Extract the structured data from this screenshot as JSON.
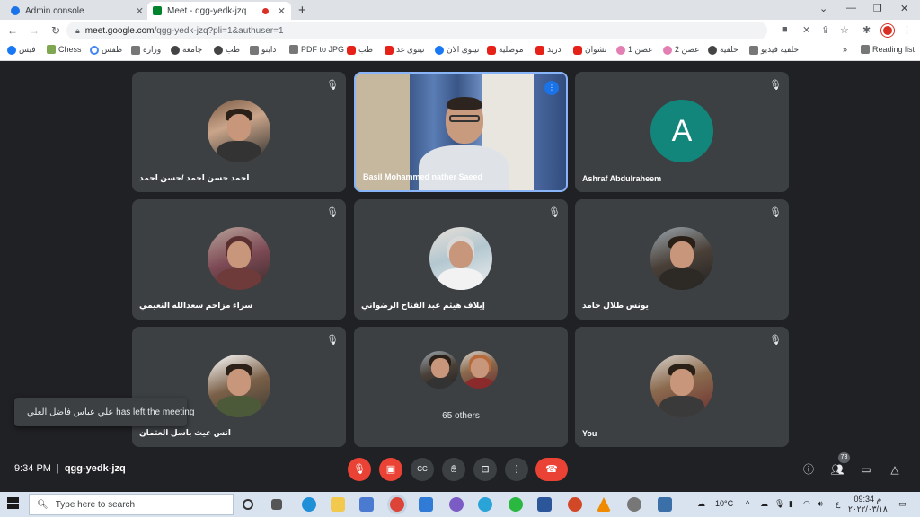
{
  "browser": {
    "tabs": [
      {
        "label": "Admin console",
        "active": false
      },
      {
        "label": "Meet - qgg-yedk-jzq",
        "active": true,
        "recording": true
      }
    ],
    "new_tab": "+",
    "window_controls": {
      "minimize": "⌄",
      "min2": "—",
      "maximize": "❐",
      "close": "✕"
    },
    "url_host": "meet.google.com",
    "url_path": "/qgg-yedk-jzq?pli=1&authuser=1",
    "bookmarks": [
      {
        "label": "فيس",
        "icon": "facebook-icon"
      },
      {
        "label": "Chess",
        "icon": "chess-icon"
      },
      {
        "label": "طقس",
        "icon": "google-icon"
      },
      {
        "label": "وزارة",
        "icon": "globe-icon"
      },
      {
        "label": "جامعة",
        "icon": "avatar-icon"
      },
      {
        "label": "طب",
        "icon": "avatar-icon"
      },
      {
        "label": "داينو",
        "icon": "dino-icon"
      },
      {
        "label": "PDF to JPG",
        "icon": "pdf-icon"
      },
      {
        "label": "طب",
        "icon": "youtube-icon"
      },
      {
        "label": "نينوى غد",
        "icon": "youtube-icon"
      },
      {
        "label": "نينوى الان",
        "icon": "facebook-icon"
      },
      {
        "label": "موصلية",
        "icon": "youtube-icon"
      },
      {
        "label": "دريد",
        "icon": "youtube-icon"
      },
      {
        "label": "نشوان",
        "icon": "youtube-icon"
      },
      {
        "label": "عصن 1",
        "icon": "flower-icon"
      },
      {
        "label": "عصن 2",
        "icon": "flower-icon"
      },
      {
        "label": "خلفية",
        "icon": "graduation-icon"
      },
      {
        "label": "خلفية فيديو",
        "icon": "video-icon"
      }
    ],
    "bookmarks_more": "»",
    "reading_list": "Reading list"
  },
  "meet": {
    "tiles": [
      {
        "name": "احمد حسن احمد /حسن احمد",
        "muted": true,
        "type": "photo"
      },
      {
        "name": "Basil Mohammed nather Saeed",
        "muted": false,
        "type": "speaker",
        "speaking": true
      },
      {
        "name": "Ashraf Abdulraheem",
        "muted": true,
        "type": "letter",
        "letter": "A"
      },
      {
        "name": "سراء مزاحم سعدالله النعيمي",
        "muted": true,
        "type": "photo"
      },
      {
        "name": "إيلاف هيثم عبد الفتاح الرضواني",
        "muted": true,
        "type": "photo"
      },
      {
        "name": "يونس طلال حامد",
        "muted": true,
        "type": "photo"
      },
      {
        "name": "انس غيث باسل العثمان",
        "muted": true,
        "type": "photo"
      },
      {
        "name": "65 others",
        "muted": false,
        "type": "others"
      },
      {
        "name": "You",
        "muted": true,
        "type": "photo"
      }
    ],
    "toast": "علي عباس فاضل العلي has left the meeting",
    "time": "9:34 PM",
    "separator": "|",
    "meeting_code": "qgg-yedk-jzq",
    "people_count": "73",
    "colors": {
      "background": "#202124",
      "tile": "#3c4043",
      "accent": "#8ab4f8",
      "danger": "#ea4335",
      "avatar_letter_bg": "#12867b"
    }
  },
  "taskbar": {
    "search_placeholder": "Type here to search",
    "weather": "10°C",
    "lang": "ع",
    "time": "09:34 م",
    "date": "٢٠٢٢/٠٣/١٨"
  }
}
